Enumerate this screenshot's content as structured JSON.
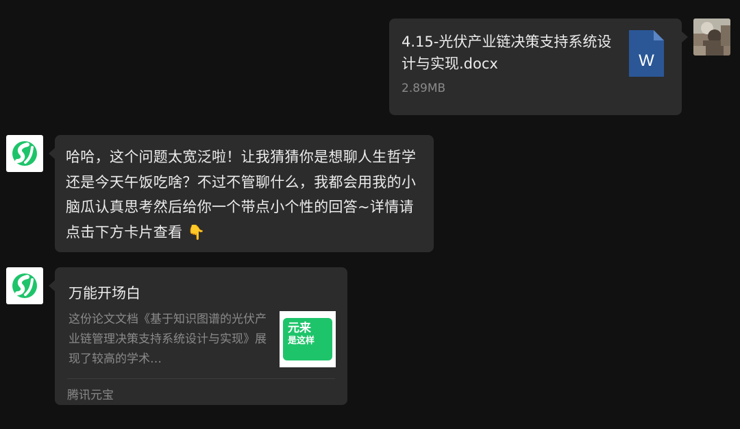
{
  "outgoing_file": {
    "file_name": "4.15-光伏产业链决策支持系统设计与实现.docx",
    "file_size": "2.89MB",
    "file_type_icon": "word-document-icon",
    "icon_letter": "W",
    "icon_color": "#2b5797"
  },
  "bot_reply": {
    "text": "哈哈，这个问题太宽泛啦！让我猜猜你是想聊人生哲学还是今天午饭吃啥？不过不管聊什么，我都会用我的小脑瓜认真思考然后给你一个带点小个性的回答~详情请点击下方卡片查看 👇"
  },
  "share_card": {
    "title": "万能开场白",
    "description": "这份论文文档《基于知识图谱的光伏产业链管理决策支持系统设计与实现》展现了较高的学术…",
    "thumbnail_line1": "元来",
    "thumbnail_line2": "是这样",
    "source": "腾讯元宝"
  },
  "colors": {
    "background": "#111111",
    "bubble": "#2c2c2c",
    "bot_brand": "#1ec46a"
  }
}
